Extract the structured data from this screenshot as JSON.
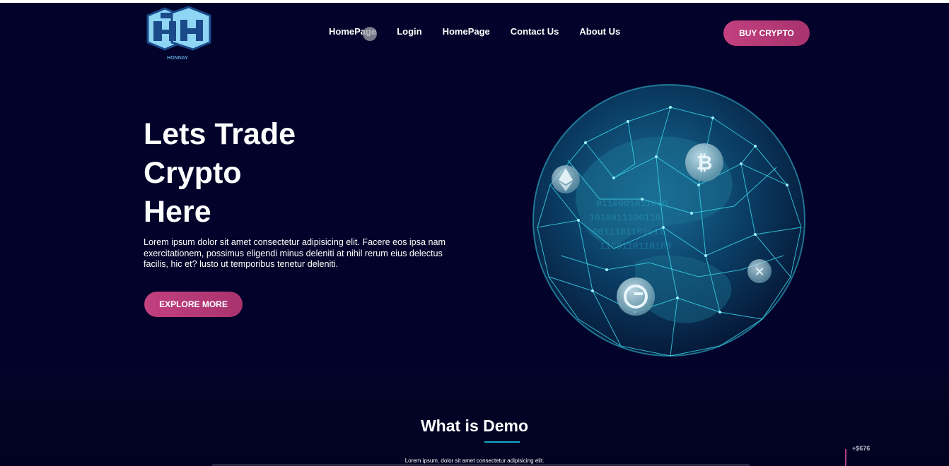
{
  "header": {
    "logo_text": "HONNAY",
    "nav": [
      {
        "label": "HomePage"
      },
      {
        "label": "Login"
      },
      {
        "label": "HomePage"
      },
      {
        "label": "Contact Us"
      },
      {
        "label": "About Us"
      }
    ],
    "cta_label": "BUY CRYPTO"
  },
  "hero": {
    "title_lines": [
      "Lets Trade",
      "Crypto",
      "Here"
    ],
    "description": "Lorem ipsum dolor sit amet consectetur adipisicing elit. Facere eos ipsa nam exercitationem, possimus eligendi minus deleniti at nihil rerum eius delectus facilis, hic et? lusto ut temporibus tenetur deleniti.",
    "cta_label": "EXPLORE MORE"
  },
  "about": {
    "title": "What is Demo",
    "subtitle": "Lorem ipsum, dolor sit amet consectetur adipisicing elit."
  },
  "ticker": {
    "value": "+$676"
  },
  "colors": {
    "background": "#02022a",
    "accent_pink": "#c2407f",
    "accent_cyan": "#1aa8c8",
    "logo_blue": "#8fd6f5"
  },
  "icons": [
    "logo-icon",
    "globe-illustration",
    "bitcoin-icon",
    "ethereum-icon",
    "ripple-icon",
    "coin-icon"
  ]
}
